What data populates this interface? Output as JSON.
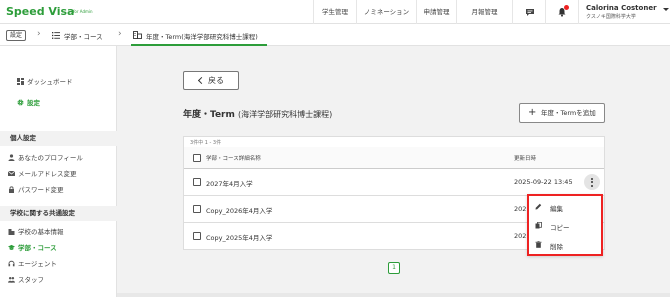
{
  "header": {
    "brand": "Speed Visa",
    "brand_sub": "for Admin",
    "nav": [
      "学生管理",
      "ノミネーション",
      "申請管理",
      "月報管理"
    ],
    "notification_badge": "",
    "user_name": "Calorina Costoner",
    "user_org": "クスノキ国際科学大学"
  },
  "breadcrumb": {
    "settings": "設定",
    "item1": "学部・コース",
    "item2": "年度・Term(海洋学部研究科博士課程)"
  },
  "sidebar": {
    "dashboard": "ダッシュボード",
    "settings": "設定",
    "personal_section": "個人設定",
    "personal_items": [
      "あなたのプロフィール",
      "メールアドレス変更",
      "パスワード変更"
    ],
    "school_section": "学校に関する共通設定",
    "school_items": [
      "学校の基本情報",
      "学部・コース",
      "エージェント",
      "スタッフ"
    ]
  },
  "main": {
    "back_label": "戻る",
    "title": "年度・Term",
    "title_sub": "(海洋学部研究科博士課程)",
    "add_label": "年度・Termを追加",
    "table": {
      "count": "3件中 1 - 3件",
      "col_name": "学部・コース詳細名称",
      "col_updated": "更新日時",
      "rows": [
        {
          "name": "2027年4月入学",
          "updated": "2025-09-22 13:45"
        },
        {
          "name": "Copy_2026年4月入学",
          "updated": "202"
        },
        {
          "name": "Copy_2025年4月入学",
          "updated": "202"
        }
      ]
    },
    "menu": {
      "edit": "編集",
      "copy": "コピー",
      "delete": "削除"
    },
    "page": "1"
  },
  "colors": {
    "brand_green": "#2d9d3a",
    "highlight_red": "#e22"
  }
}
